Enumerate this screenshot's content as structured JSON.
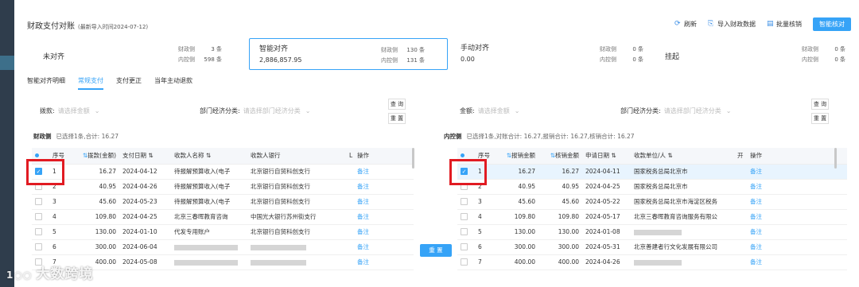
{
  "header": {
    "title": "财政支付对账",
    "subtitle": "(最新导入时间2024-07-12)",
    "actions": {
      "refresh": "刷新",
      "import": "导入财政数据",
      "batch": "批量核销",
      "smart": "智能核对"
    }
  },
  "summary": {
    "unmatched": {
      "name": "未对齐",
      "fin_label": "财政侧",
      "fin_value": "3 条",
      "int_label": "内控侧",
      "int_value": "598 条"
    },
    "smart": {
      "name": "智能对齐",
      "amount": "2,886,857.95",
      "fin_label": "财政侧",
      "fin_value": "130 条",
      "int_label": "内控侧",
      "int_value": "131 条"
    },
    "manual": {
      "name": "手动对齐",
      "amount": "0.00",
      "fin_label": "财政侧",
      "fin_value": "0 条",
      "int_label": "内控侧",
      "int_value": "0 条"
    },
    "suspend": {
      "name": "挂起",
      "fin_label": "财政侧",
      "fin_value": "0 条",
      "int_label": "内控侧",
      "int_value": "0 条"
    }
  },
  "tabs": {
    "label": "智能对齐明细",
    "items": [
      "常规支付",
      "支付更正",
      "当年主动退款"
    ]
  },
  "left": {
    "filter1_label": "拨款:",
    "filter1_ph": "请选择金额",
    "filter2_label": "部门经济分类:",
    "filter2_ph": "请选择部门经济分类",
    "query": "查 询",
    "reset": "重 置",
    "info_side": "财政侧",
    "info_text": "已选择1条,合计: 16.27",
    "cols": [
      "序号",
      "拨款(金额)",
      "支付日期 ⇅",
      "收款人名称 ⇅",
      "收款人银行",
      "L",
      "操作"
    ],
    "rows": [
      {
        "no": "1",
        "amount": "16.27",
        "date": "2024-04-12",
        "payee": "待报解预算收入(电子",
        "bank": "北京银行自贸科创支行",
        "op": "备注"
      },
      {
        "no": "2",
        "amount": "40.95",
        "date": "2024-04-26",
        "payee": "待报解预算收入(电子",
        "bank": "北京银行自贸科创支行",
        "op": "备注"
      },
      {
        "no": "3",
        "amount": "45.60",
        "date": "2024-05-23",
        "payee": "待报解预算收入(电子",
        "bank": "北京银行自贸科创支行",
        "op": "备注"
      },
      {
        "no": "4",
        "amount": "109.80",
        "date": "2024-04-25",
        "payee": "北京三春晖教育咨询",
        "bank": "中国光大银行苏州街支行",
        "op": "备注"
      },
      {
        "no": "5",
        "amount": "130.00",
        "date": "2024-01-10",
        "payee": "代发专用账户",
        "bank": "北京银行自贸科创支行",
        "op": "备注"
      },
      {
        "no": "6",
        "amount": "300.00",
        "date": "2024-06-04",
        "payee": "",
        "bank": "",
        "op": "备注"
      },
      {
        "no": "7",
        "amount": "400.00",
        "date": "2024-05-08",
        "payee": "",
        "bank": "",
        "op": "备注"
      }
    ]
  },
  "right": {
    "filter1_label": "金额:",
    "filter1_ph": "请选择金额",
    "filter2_label": "部门经济分类:",
    "filter2_ph": "请选择部门经济分类",
    "query": "查 询",
    "reset": "重 置",
    "info_side": "内控侧",
    "info_text": "已选择1条,对账合计: 16.27,报销合计: 16.27,核销合计: 16.27",
    "cols": [
      "序号",
      "报销金额",
      "核销金额",
      "申请日期 ⇅",
      "收款单位/人 ⇅",
      "开",
      "操作"
    ],
    "rows": [
      {
        "no": "1",
        "amt1": "16.27",
        "amt2": "16.27",
        "date": "2024-04-11",
        "payee": "国家税务总局北京市",
        "op": "备注"
      },
      {
        "no": "2",
        "amt1": "40.95",
        "amt2": "40.95",
        "date": "2024-04-25",
        "payee": "国家税务总局北京市",
        "op": "备注"
      },
      {
        "no": "3",
        "amt1": "45.60",
        "amt2": "45.60",
        "date": "2024-05-22",
        "payee": "国家税务总局北京市海淀区税务",
        "op": "备注"
      },
      {
        "no": "4",
        "amt1": "109.80",
        "amt2": "109.80",
        "date": "2024-05-17",
        "payee": "北京三春晖教育咨询服务有限公",
        "op": "备注"
      },
      {
        "no": "5",
        "amt1": "130.00",
        "amt2": "130.00",
        "date": "2024-01-08",
        "payee": "",
        "op": "备注"
      },
      {
        "no": "6",
        "amt1": "300.00",
        "amt2": "300.00",
        "date": "2024-05-31",
        "payee": "北京善建者行文化发展有限公司",
        "op": "备注"
      },
      {
        "no": "7",
        "amt1": "400.00",
        "amt2": "400.00",
        "date": "2024-04-26",
        "payee": "",
        "op": "备注"
      }
    ]
  },
  "middle_reset": "重 置",
  "watermark": "大数跨境",
  "colors": {
    "accent": "#36a3f7",
    "highlight_box": "#e11b22",
    "selected_row": "#e8f4fe"
  }
}
